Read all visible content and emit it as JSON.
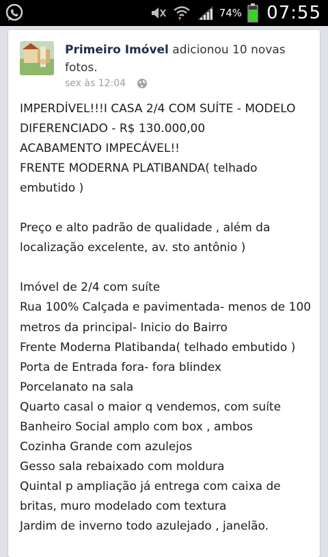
{
  "status_bar": {
    "battery_percent": "74%",
    "clock": "07:55",
    "icons": [
      "whatsapp-icon",
      "mute-icon",
      "wifi-icon",
      "signal-icon",
      "battery-icon"
    ],
    "battery_color": "#3ad12a"
  },
  "post": {
    "page_name": "Primeiro Imóvel",
    "action_text": " adicionou 10 novas fotos.",
    "timestamp": "sex às 12:04",
    "privacy_icon": "globe-icon",
    "lines": [
      "IMPERDÍVEL!!!I CASA 2/4 COM SUÍTE - MODELO DIFERENCIADO - R$ 130.000,00",
      "ACABAMENTO IMPECÁVEL!!",
      "FRENTE MODERNA PLATIBANDA( telhado embutido )",
      "",
      "Preço e alto padrão de qualidade , além da localização excelente, av. sto antônio )",
      "",
      "Imóvel de 2/4 com suíte",
      "Rua 100% Calçada e pavimentada- menos de 100 metros da principal- Inicio do Bairro",
      "Frente Moderna Platibanda( telhado embutido )",
      "Porta de Entrada fora- fora blindex",
      "Porcelanato na sala",
      "Quarto casal o maior q vendemos, com suíte",
      "Banheiro Social amplo com box , ambos",
      "Cozinha Grande com azulejos",
      "Gesso sala rebaixado com moldura",
      "Quintal p ampliação já entrega com caixa de britas, muro modelado com textura",
      "Jardim de inverno todo azulejado , janelão."
    ]
  }
}
